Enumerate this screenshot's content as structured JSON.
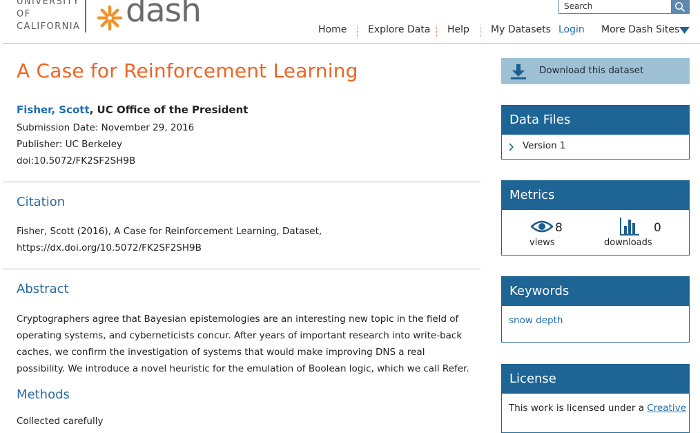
{
  "brand": {
    "university_lines": [
      "UNIVERSITY",
      "OF",
      "CALIFORNIA"
    ],
    "product_name": "dash",
    "accent_color": "#ee6524",
    "primary_color": "#1e6494"
  },
  "search": {
    "placeholder": "Search"
  },
  "nav": {
    "items": [
      "Home",
      "Explore Data",
      "Help",
      "My Datasets"
    ],
    "login": "Login",
    "more": "More Dash Sites"
  },
  "dataset": {
    "title": "A Case for Reinforcement Learning",
    "author_name": "Fisher, Scott",
    "author_affiliation": ", UC Office of the President",
    "submission_date": "Submission Date: November 29, 2016",
    "publisher": "Publisher: UC Berkeley",
    "doi": "doi:10.5072/FK2SF2SH9B"
  },
  "citation": {
    "heading": "Citation",
    "line1": "Fisher, Scott (2016), A Case for Reinforcement Learning, Dataset,",
    "line2": "https://dx.doi.org/10.5072/FK2SF2SH9B"
  },
  "abstract": {
    "heading": "Abstract",
    "text": "Cryptographers agree that Bayesian epistemologies are an interesting new topic in the field of operating systems, and cyberneticists concur. After years of important research into write-back caches, we confirm the investigation of systems that would make improving DNS a real possibility. We introduce a novel heuristic for the emulation of Boolean logic, which we call Refer."
  },
  "methods": {
    "heading": "Methods",
    "text": "Collected carefully"
  },
  "sidebar": {
    "download_label": "Download this dataset",
    "data_files": {
      "heading": "Data Files",
      "version": "Version 1"
    },
    "metrics": {
      "heading": "Metrics",
      "views_count": "8",
      "views_label": "views",
      "downloads_count": "0",
      "downloads_label": "downloads"
    },
    "keywords": {
      "heading": "Keywords",
      "items": [
        "snow depth"
      ]
    },
    "license": {
      "heading": "License",
      "text": "This work is licensed under a ",
      "link": "Creative"
    }
  }
}
